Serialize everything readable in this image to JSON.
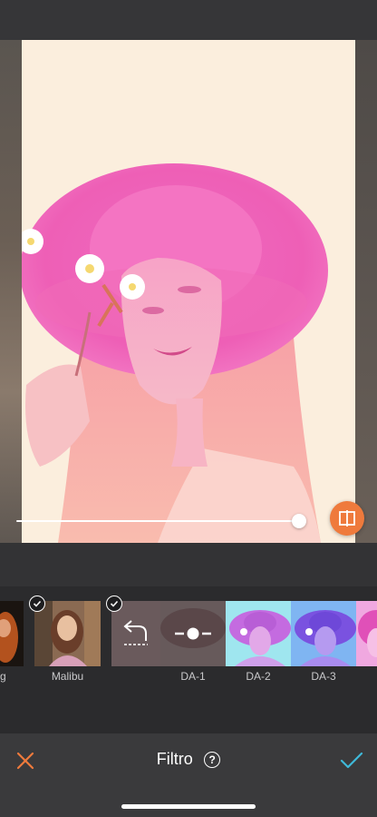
{
  "editor": {
    "title": "Filtro",
    "help_symbol": "?",
    "cancel_icon": "close-icon",
    "confirm_icon": "checkmark-icon",
    "accent_orange": "#ef7a3c",
    "accent_teal": "#3fb9d9"
  },
  "intensity_slider": {
    "value": 0.97
  },
  "compare_button": {
    "icon": "compare-split-icon"
  },
  "filters": [
    {
      "label": "g",
      "selected": false
    },
    {
      "label": "Malibu",
      "selected": true
    },
    {
      "label": "",
      "icon": "undo-icon",
      "selected": true
    },
    {
      "label": "DA-1",
      "icon": "adjust-slider-icon"
    },
    {
      "label": "DA-2"
    },
    {
      "label": "DA-3"
    },
    {
      "label": ""
    }
  ]
}
